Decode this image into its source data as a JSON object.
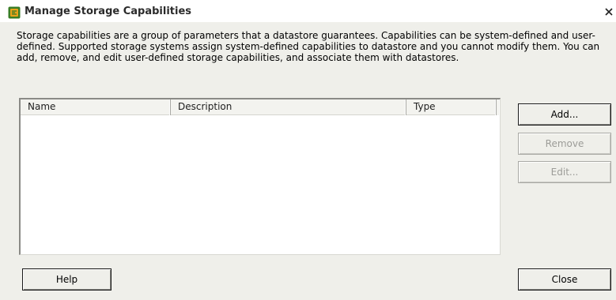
{
  "dialog": {
    "title": "Manage Storage Capabilities",
    "icon": "vsphere-app-icon",
    "close_glyph": "close-icon",
    "description": "Storage capabilities are a group of parameters that a datastore guarantees. Capabilities can be system-defined and user-defined. Supported storage systems assign system-defined capabilities to datastore and you cannot modify them. You can add, remove, and edit user-defined storage capabilities, and associate them with datastores."
  },
  "table": {
    "columns": [
      "Name",
      "Description",
      "Type"
    ],
    "rows": []
  },
  "buttons": {
    "add": "Add...",
    "remove": "Remove",
    "edit": "Edit...",
    "help": "Help",
    "close": "Close"
  },
  "colors": {
    "dialog_bg": "#efefea",
    "icon_accent": "#e8a21a",
    "disabled_text": "#9c9c98"
  }
}
